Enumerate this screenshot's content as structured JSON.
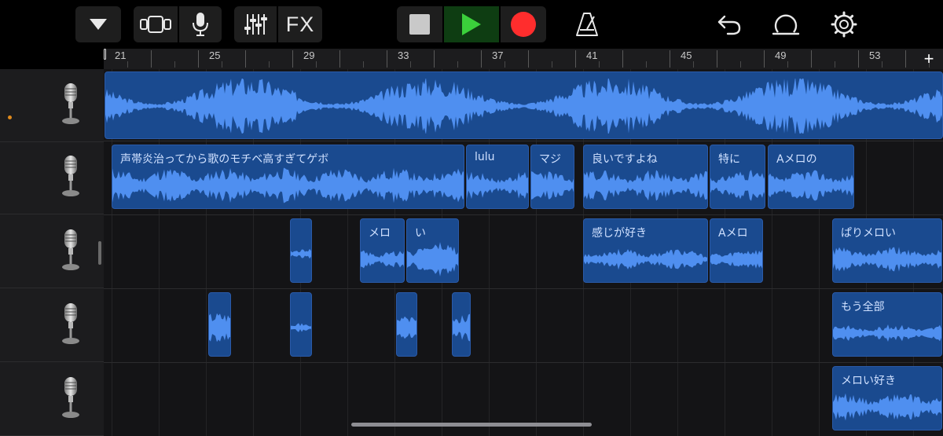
{
  "ruler": {
    "bars": [
      "21",
      "25",
      "29",
      "33",
      "37",
      "41",
      "45",
      "49",
      "53"
    ],
    "add_label": "+"
  },
  "toolbar": {
    "fx_label": "FX"
  },
  "colors": {
    "region": "#1a4a8f",
    "waveform": "#4f8ff0",
    "record": "#ff2d2d",
    "play": "#3bd03b",
    "track_dot": "#e08a1c"
  },
  "tracks": [
    {
      "icon": "microphone-icon",
      "regions": [
        {
          "label": "",
          "seed": 3,
          "amp": 0.55,
          "dense": true
        }
      ]
    },
    {
      "icon": "microphone-icon",
      "regions": [
        {
          "label": "声帯炎治ってから歌のモチベ高すぎてゲボ",
          "seed": 11,
          "amp": 0.5
        },
        {
          "label": "lulu",
          "seed": 17,
          "amp": 0.4
        },
        {
          "label": "マジ",
          "seed": 23,
          "amp": 0.45
        },
        {
          "label": "良いですよね",
          "seed": 29,
          "amp": 0.45
        },
        {
          "label": "特に",
          "seed": 31,
          "amp": 0.45
        },
        {
          "label": "Aメロの",
          "seed": 37,
          "amp": 0.45
        }
      ]
    },
    {
      "icon": "microphone-icon",
      "regions": [
        {
          "label": "",
          "seed": 41,
          "amp": 0.12
        },
        {
          "label": "メロ",
          "seed": 43,
          "amp": 0.3
        },
        {
          "label": "い",
          "seed": 47,
          "amp": 0.5
        },
        {
          "label": "感じが好き",
          "seed": 53,
          "amp": 0.3
        },
        {
          "label": "Aメロ",
          "seed": 59,
          "amp": 0.3
        },
        {
          "label": "ぱりメロい",
          "seed": 61,
          "amp": 0.35
        }
      ]
    },
    {
      "icon": "microphone-icon",
      "regions": [
        {
          "label": "",
          "seed": 67,
          "amp": 0.35
        },
        {
          "label": "",
          "seed": 71,
          "amp": 0.12
        },
        {
          "label": "",
          "seed": 73,
          "amp": 0.25
        },
        {
          "label": "",
          "seed": 79,
          "amp": 0.3
        },
        {
          "label": "もう全部",
          "seed": 83,
          "amp": 0.25
        }
      ]
    },
    {
      "icon": "microphone-icon",
      "regions": [
        {
          "label": "メロい好き",
          "seed": 89,
          "amp": 0.4
        }
      ]
    }
  ]
}
